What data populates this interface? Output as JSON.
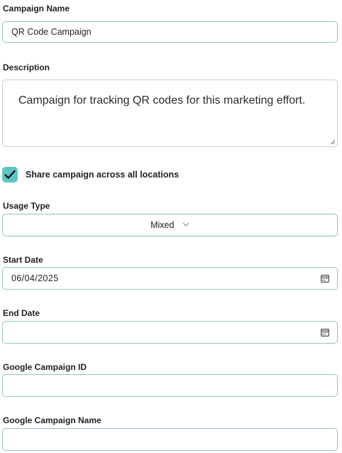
{
  "campaign_name": {
    "label": "Campaign Name",
    "value": "QR Code Campaign"
  },
  "description": {
    "label": "Description",
    "value": "Campaign for tracking QR codes for this marketing effort."
  },
  "share": {
    "label": "Share campaign across all locations",
    "checked": true
  },
  "usage_type": {
    "label": "Usage Type",
    "selected": "Mixed"
  },
  "start_date": {
    "label": "Start Date",
    "value": "06/04/2025"
  },
  "end_date": {
    "label": "End Date",
    "value": ""
  },
  "google_campaign_id": {
    "label": "Google Campaign ID",
    "value": ""
  },
  "google_campaign_name": {
    "label": "Google Campaign Name",
    "value": ""
  },
  "icons": {
    "checkbox": "checkmark-icon",
    "select": "chevron-down-icon",
    "date": "calendar-icon"
  },
  "colors": {
    "accent": "#5cc6c2",
    "field_border": "#8fc4c2",
    "textarea_border": "#c9cfd1"
  }
}
